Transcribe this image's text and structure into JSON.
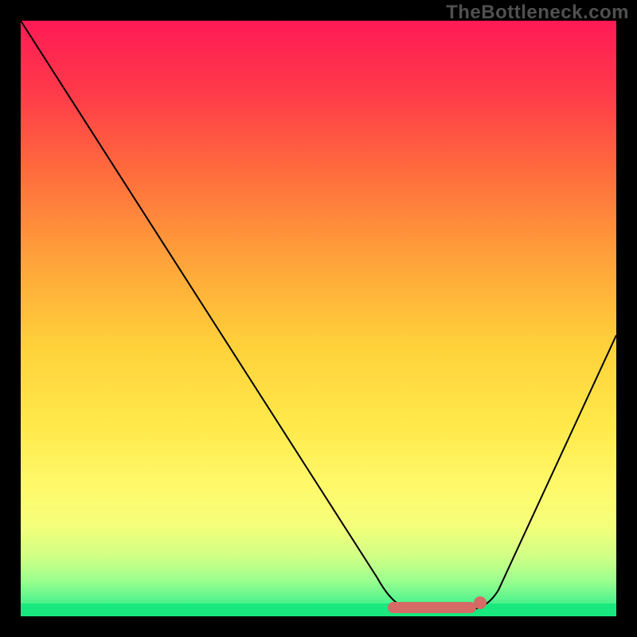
{
  "watermark": "TheBottleneck.com",
  "colors": {
    "gradient_top": "#ff1a55",
    "gradient_bottom": "#18e87e",
    "curve": "#000000",
    "marker": "#d66a65",
    "frame": "#000000"
  },
  "chart_data": {
    "type": "line",
    "title": "",
    "xlabel": "",
    "ylabel": "",
    "xlim": [
      0,
      100
    ],
    "ylim": [
      0,
      100
    ],
    "x": [
      0,
      5,
      10,
      15,
      20,
      25,
      30,
      35,
      40,
      45,
      50,
      55,
      60,
      62,
      65,
      68,
      70,
      72,
      75,
      78,
      80,
      85,
      90,
      95,
      100
    ],
    "values": [
      100,
      93,
      86,
      79,
      72,
      65,
      58,
      51,
      44,
      37,
      30,
      23,
      12,
      6,
      2,
      0.5,
      0.5,
      0.5,
      0.7,
      1,
      3,
      12,
      24,
      36,
      48
    ],
    "marker_segment": {
      "x_start": 62,
      "x_end": 76,
      "y": 0.5
    },
    "marker_dot": {
      "x": 77,
      "y": 1
    },
    "grid": false,
    "legend": false
  }
}
